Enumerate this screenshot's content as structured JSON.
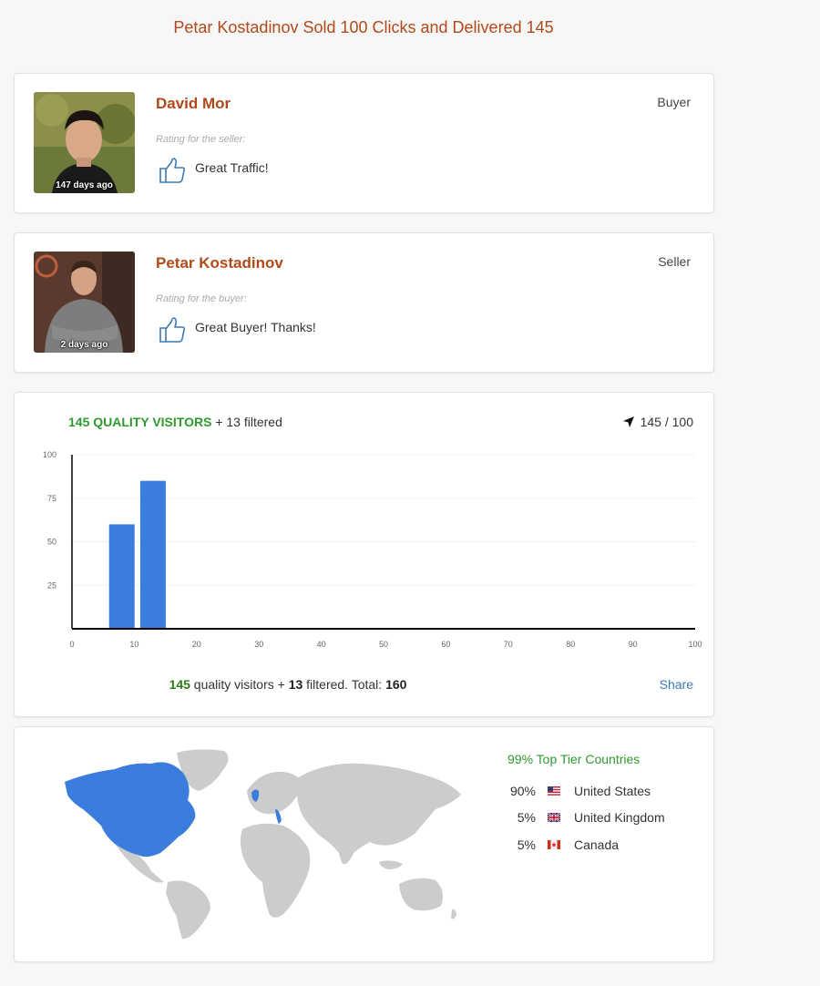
{
  "page": {
    "title": "Petar Kostadinov Sold 100 Clicks and Delivered 145"
  },
  "reviews": [
    {
      "name": "David Mor",
      "role": "Buyer",
      "time_ago": "147 days ago",
      "rating_label": "Rating for the seller:",
      "rating_text": "Great Traffic!"
    },
    {
      "name": "Petar Kostadinov",
      "role": "Seller",
      "time_ago": "2 days ago",
      "rating_label": "Rating for the buyer:",
      "rating_text": "Great Buyer! Thanks!"
    }
  ],
  "traffic": {
    "quality_label": "145 QUALITY VISITORS",
    "filtered_label": "+ 13 filtered",
    "progress_text": "145 / 100",
    "summary": {
      "quality": "145",
      "quality_suffix": " quality visitors + ",
      "filtered": "13",
      "filtered_suffix": " filtered. Total: ",
      "total": "160"
    },
    "share_label": "Share"
  },
  "chart_data": {
    "type": "bar",
    "x": [
      8,
      13
    ],
    "values": [
      60,
      85
    ],
    "xlim": [
      0,
      100
    ],
    "ylim": [
      0,
      100
    ],
    "xticks": [
      "0",
      "10",
      "20",
      "30",
      "40",
      "50",
      "60",
      "70",
      "80",
      "90",
      "100"
    ],
    "yticks": [
      "25",
      "50",
      "75",
      "100"
    ],
    "bar_color": "#3b7ddd",
    "grid": true
  },
  "geo": {
    "top_tier_label": "99% Top Tier Countries",
    "countries": [
      {
        "pct": "90%",
        "name": "United States",
        "flag_icon": "us-flag-icon"
      },
      {
        "pct": "5%",
        "name": "United Kingdom",
        "flag_icon": "uk-flag-icon"
      },
      {
        "pct": "5%",
        "name": "Canada",
        "flag_icon": "canada-flag-icon"
      }
    ],
    "highlight_color": "#3b7ddd",
    "land_color": "#cccccc"
  },
  "colors": {
    "accent": "#b04a1a",
    "green": "#2e9a2e",
    "link": "#3a7ab5"
  }
}
